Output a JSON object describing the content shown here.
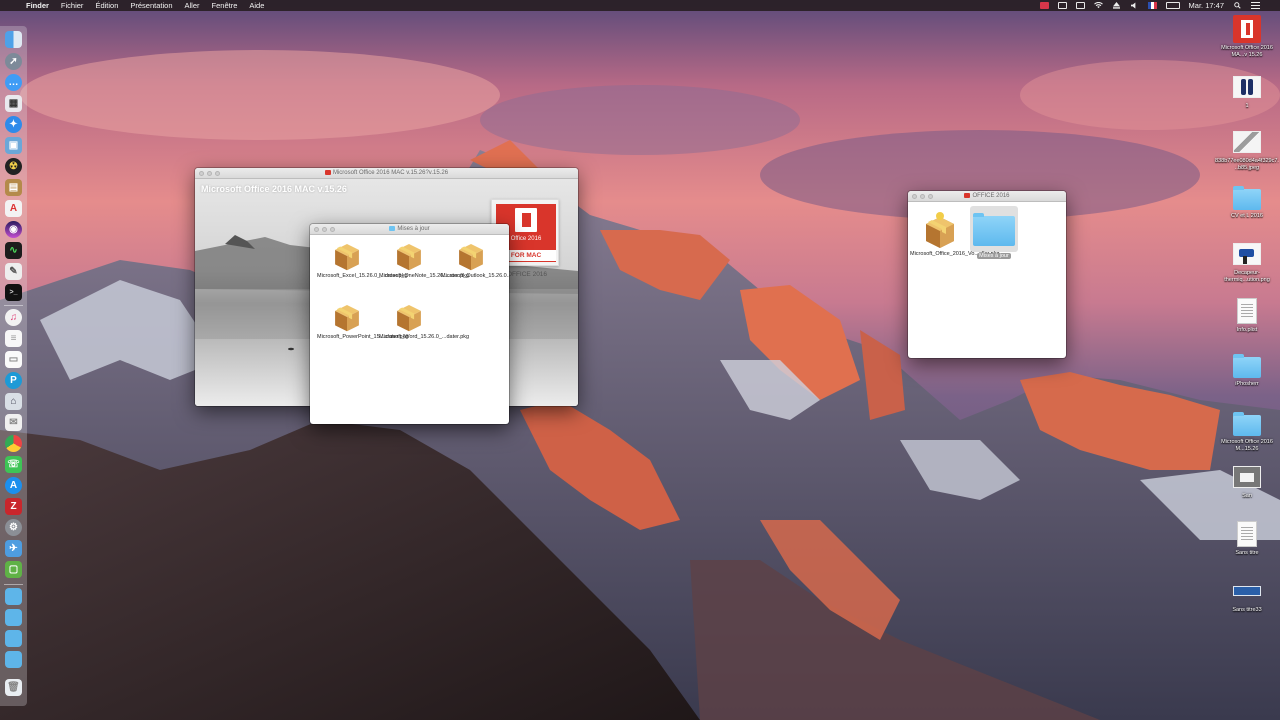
{
  "menubar": {
    "app": "Finder",
    "items": [
      "Fichier",
      "Édition",
      "Présentation",
      "Aller",
      "Fenêtre",
      "Aide"
    ],
    "clock": "Mar. 17:47"
  },
  "dock": {
    "apps": [
      "Finder",
      "Launchpad",
      "Messages",
      "Photos",
      "Safari",
      "Preview",
      "Radiation",
      "Notes",
      "TextEdit",
      "Siri",
      "Activity Monitor",
      "Script Editor",
      "Terminal",
      "iTunes",
      "Notes",
      "Pages",
      "Tool",
      "Notes",
      "Chrome",
      "WhatsApp",
      "App Store",
      "FileZilla",
      "System Preferences",
      "Mail",
      "Mobile",
      "Folder",
      "Folder",
      "Folder",
      "Folder",
      "Trash"
    ]
  },
  "desktop_icons": [
    {
      "label": "Microsoft Office 2016 MA...v 15.26",
      "icon": "office-app-icon"
    },
    {
      "label": "1",
      "icon": "image-icon"
    },
    {
      "label": "838b77ee080d4a4f329c7...b85.jpeg",
      "icon": "image-icon"
    },
    {
      "label": "CV et L 2016",
      "icon": "folder-icon"
    },
    {
      "label": "Decapeur-thermiq...ution.png",
      "icon": "image-icon"
    },
    {
      "label": "Info.plist",
      "icon": "document-icon"
    },
    {
      "label": "iPhosherr",
      "icon": "folder-icon"
    },
    {
      "label": "Microsoft Office 2016 M...15.26",
      "icon": "folder-icon"
    },
    {
      "label": "San",
      "icon": "image-icon"
    },
    {
      "label": "Sans titre",
      "icon": "document-icon"
    },
    {
      "label": "Sans titre33",
      "icon": "image-icon"
    }
  ],
  "dmg_window": {
    "title": "Microsoft Office 2016 MAC v.15.26?v.15.26",
    "heading": "Microsoft Office 2016 MAC v.15.26",
    "card_office_text": "Office 2016",
    "card_for_mac": "FOR MAC",
    "caption": "OFFICE 2016"
  },
  "updates_window": {
    "title": "Mises à jour",
    "packages": [
      "Microsoft_Excel_15.26.0_...dater.pkg",
      "Microsoft_OneNote_15.26....ater.pkg",
      "Microsoft_Outlook_15.26.0...ater.pkg",
      "Microsoft_PowerPoint_15....dater.pkg",
      "Microsoft_Word_15.26.0_...dater.pkg"
    ]
  },
  "office_window": {
    "title": "OFFICE 2016",
    "items": [
      {
        "label": "Microsoft_Office_2016_Vo...eller.pkg",
        "icon": "package-icon"
      },
      {
        "label": "Mises à jour",
        "icon": "folder-icon",
        "selected": true
      }
    ]
  }
}
